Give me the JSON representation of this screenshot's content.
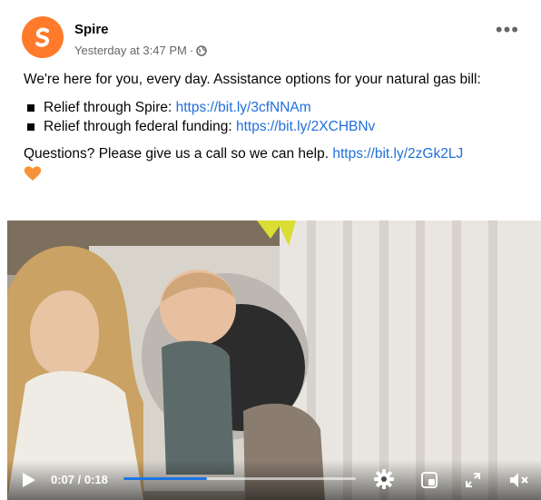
{
  "post": {
    "author": "Spire",
    "timestamp": "Yesterday at 3:47 PM",
    "separator": "·",
    "more_label": "•••",
    "intro": "We're here for you, every day. Assistance options for your natural gas bill:",
    "bullets": [
      {
        "text": "Relief through Spire: ",
        "link": "https://bit.ly/3cfNNAm"
      },
      {
        "text": "Relief through federal funding: ",
        "link": "https://bit.ly/2XCHBNv"
      }
    ],
    "closing_text": "Questions? Please give us a call so we can help. ",
    "closing_link": "https://bit.ly/2zGk2LJ"
  },
  "video": {
    "current_time": "0:07",
    "duration": "0:18",
    "time_label": "0:07 / 0:18",
    "progress": 0.36
  },
  "colors": {
    "brand": "#ff7a2a",
    "link": "#216fdb",
    "progress": "#1b74e4",
    "heart": "#f7923a"
  },
  "icons": {
    "avatar": "spire-logo-icon",
    "privacy": "globe-icon",
    "more": "more-icon",
    "bullet": "square-bullet-icon",
    "heart": "orange-heart-icon",
    "play": "play-icon",
    "settings": "gear-icon",
    "pip": "picture-in-picture-icon",
    "fullscreen": "expand-icon",
    "mute": "muted-speaker-icon"
  }
}
